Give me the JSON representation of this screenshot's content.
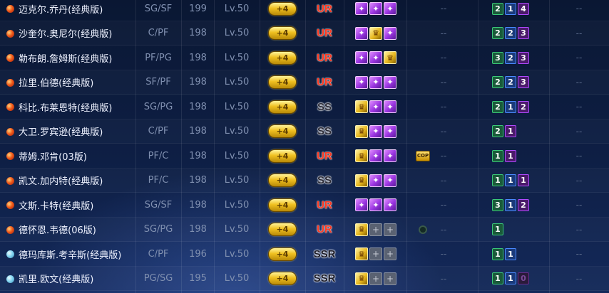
{
  "table": {
    "rows": [
      {
        "name": "迈克尔.乔丹(经典版)",
        "dot": "red",
        "position": "SG/SF",
        "rating": "199",
        "level": "Lv.50",
        "plus": "+4",
        "grade": "UR",
        "skills": [
          "purple",
          "purple",
          "purple"
        ],
        "extra": "",
        "dash1": "--",
        "boxes": [
          {
            "v": "2",
            "c": "g"
          },
          {
            "v": "1",
            "c": "b"
          },
          {
            "v": "4",
            "c": "p"
          }
        ],
        "dash2": "--"
      },
      {
        "name": "沙奎尔.奥尼尔(经典版)",
        "dot": "red",
        "position": "C/PF",
        "rating": "198",
        "level": "Lv.50",
        "plus": "+4",
        "grade": "UR",
        "skills": [
          "purple",
          "gold",
          "purple"
        ],
        "extra": "",
        "dash1": "--",
        "boxes": [
          {
            "v": "2",
            "c": "g"
          },
          {
            "v": "2",
            "c": "b"
          },
          {
            "v": "3",
            "c": "p"
          }
        ],
        "dash2": "--"
      },
      {
        "name": "勒布朗.詹姆斯(经典版)",
        "dot": "red",
        "position": "PF/PG",
        "rating": "198",
        "level": "Lv.50",
        "plus": "+4",
        "grade": "UR",
        "skills": [
          "purple",
          "purple",
          "gold"
        ],
        "extra": "",
        "dash1": "--",
        "boxes": [
          {
            "v": "3",
            "c": "g"
          },
          {
            "v": "2",
            "c": "b"
          },
          {
            "v": "3",
            "c": "p"
          }
        ],
        "dash2": "--"
      },
      {
        "name": "拉里.伯德(经典版)",
        "dot": "red",
        "position": "SF/PF",
        "rating": "198",
        "level": "Lv.50",
        "plus": "+4",
        "grade": "UR",
        "skills": [
          "purple",
          "purple",
          "purple"
        ],
        "extra": "",
        "dash1": "--",
        "boxes": [
          {
            "v": "2",
            "c": "g"
          },
          {
            "v": "2",
            "c": "b"
          },
          {
            "v": "3",
            "c": "p"
          }
        ],
        "dash2": "--"
      },
      {
        "name": "科比.布莱恩特(经典版)",
        "dot": "red",
        "position": "SG/PG",
        "rating": "198",
        "level": "Lv.50",
        "plus": "+4",
        "grade": "SS",
        "skills": [
          "gold",
          "purple",
          "purple"
        ],
        "extra": "",
        "dash1": "--",
        "boxes": [
          {
            "v": "2",
            "c": "g"
          },
          {
            "v": "1",
            "c": "b"
          },
          {
            "v": "2",
            "c": "p"
          }
        ],
        "dash2": "--"
      },
      {
        "name": "大卫.罗宾逊(经典版)",
        "dot": "red",
        "position": "C/PF",
        "rating": "198",
        "level": "Lv.50",
        "plus": "+4",
        "grade": "SS",
        "skills": [
          "gold",
          "purple",
          "purple"
        ],
        "extra": "",
        "dash1": "--",
        "boxes": [
          {
            "v": "2",
            "c": "g"
          },
          {
            "v": "1",
            "c": "p"
          }
        ],
        "dash2": "--"
      },
      {
        "name": "蒂姆.邓肯(03版)",
        "dot": "red",
        "position": "PF/C",
        "rating": "198",
        "level": "Lv.50",
        "plus": "+4",
        "grade": "UR",
        "skills": [
          "gold",
          "purple",
          "purple"
        ],
        "extra": "cop",
        "dash1": "--",
        "boxes": [
          {
            "v": "1",
            "c": "g"
          },
          {
            "v": "1",
            "c": "p"
          }
        ],
        "dash2": "--"
      },
      {
        "name": "凯文.加内特(经典版)",
        "dot": "red",
        "position": "PF/C",
        "rating": "198",
        "level": "Lv.50",
        "plus": "+4",
        "grade": "SS",
        "skills": [
          "gold",
          "purple",
          "purple"
        ],
        "extra": "",
        "dash1": "--",
        "boxes": [
          {
            "v": "1",
            "c": "g"
          },
          {
            "v": "1",
            "c": "b"
          },
          {
            "v": "1",
            "c": "p"
          }
        ],
        "dash2": "--"
      },
      {
        "name": "文斯.卡特(经典版)",
        "dot": "red",
        "position": "SG/SF",
        "rating": "198",
        "level": "Lv.50",
        "plus": "+4",
        "grade": "UR",
        "skills": [
          "purple",
          "purple",
          "purple"
        ],
        "extra": "",
        "dash1": "--",
        "boxes": [
          {
            "v": "3",
            "c": "g"
          },
          {
            "v": "1",
            "c": "b"
          },
          {
            "v": "2",
            "c": "p"
          }
        ],
        "dash2": "--"
      },
      {
        "name": "德怀恩.韦德(06版)",
        "dot": "red",
        "position": "SG/PG",
        "rating": "198",
        "level": "Lv.50",
        "plus": "+4",
        "grade": "UR",
        "skills": [
          "gold",
          "empty",
          "empty"
        ],
        "extra": "ring",
        "dash1": "--",
        "boxes": [
          {
            "v": "1",
            "c": "g"
          }
        ],
        "dash2": "--"
      },
      {
        "name": "德玛库斯.考辛斯(经典版)",
        "dot": "blue",
        "position": "C/PF",
        "rating": "196",
        "level": "Lv.50",
        "plus": "+4",
        "grade": "SSR",
        "skills": [
          "gold",
          "empty",
          "empty"
        ],
        "extra": "",
        "dash1": "--",
        "boxes": [
          {
            "v": "1",
            "c": "g"
          },
          {
            "v": "1",
            "c": "b"
          }
        ],
        "dash2": "--"
      },
      {
        "name": "凯里.欧文(经典版)",
        "dot": "blue",
        "position": "PG/SG",
        "rating": "195",
        "level": "Lv.50",
        "plus": "+4",
        "grade": "SSR",
        "skills": [
          "gold",
          "empty",
          "empty"
        ],
        "extra": "",
        "dash1": "--",
        "boxes": [
          {
            "v": "1",
            "c": "g"
          },
          {
            "v": "1",
            "c": "b"
          },
          {
            "v": "0",
            "c": "p dim"
          }
        ],
        "dash2": "--"
      }
    ]
  },
  "extra_labels": {
    "cop": "COP"
  }
}
